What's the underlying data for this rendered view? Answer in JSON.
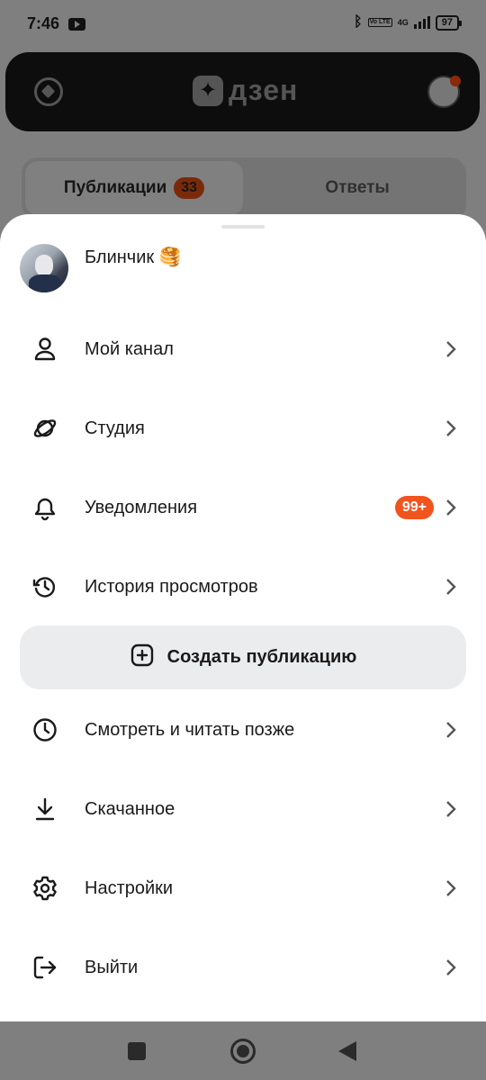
{
  "status": {
    "time": "7:46",
    "network": "4G",
    "battery": "97",
    "volte": "Vo LTE"
  },
  "app": {
    "logo_text": "дзен"
  },
  "tabs": {
    "publications": "Публикации",
    "publications_count": "33",
    "answers": "Ответы"
  },
  "profile": {
    "name": "Блинчик 🥞"
  },
  "menu": {
    "my_channel": "Мой канал",
    "studio": "Студия",
    "notifications": "Уведомления",
    "notifications_badge": "99+",
    "history": "История просмотров",
    "create_publication": "Создать публикацию",
    "watch_later": "Смотреть и читать позже",
    "downloads": "Скачанное",
    "settings": "Настройки",
    "logout": "Выйти"
  },
  "colors": {
    "badge": "#f1541d",
    "create_bg": "#ebeced",
    "scrim": "#7f7f7f"
  },
  "icons": [
    "youtube-icon",
    "bluetooth-icon",
    "compass-icon",
    "person-icon",
    "planet-icon",
    "bell-icon",
    "history-icon",
    "plus-square-icon",
    "clock-icon",
    "download-icon",
    "gear-icon",
    "logout-icon",
    "chevron-right-icon"
  ]
}
